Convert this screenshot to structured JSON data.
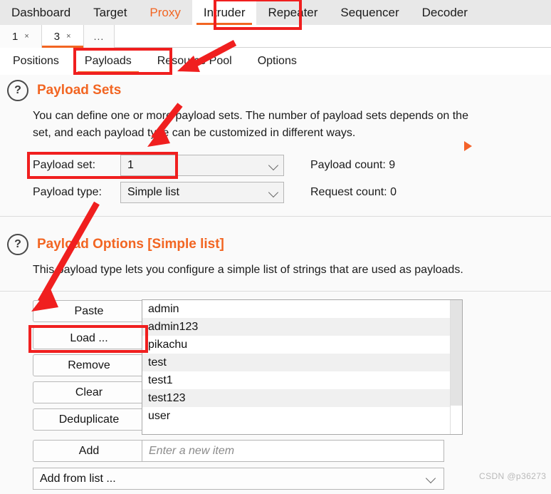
{
  "main_tabs": [
    {
      "label": "Dashboard",
      "state": "normal"
    },
    {
      "label": "Target",
      "state": "normal"
    },
    {
      "label": "Proxy",
      "state": "accent"
    },
    {
      "label": "Intruder",
      "state": "selected"
    },
    {
      "label": "Repeater",
      "state": "normal"
    },
    {
      "label": "Sequencer",
      "state": "normal"
    },
    {
      "label": "Decoder",
      "state": "normal"
    }
  ],
  "attack_tabs": [
    {
      "label": "1",
      "close": "×",
      "selected": false
    },
    {
      "label": "3",
      "close": "×",
      "selected": true
    }
  ],
  "attack_tabs_overflow": "...",
  "sub_tabs": [
    {
      "label": "Positions",
      "selected": false
    },
    {
      "label": "Payloads",
      "selected": true
    },
    {
      "label": "Resource Pool",
      "selected": false
    },
    {
      "label": "Options",
      "selected": false
    }
  ],
  "payload_sets": {
    "help_icon": "question-mark-icon",
    "title": "Payload Sets",
    "description_line1": "You can define one or more payload sets. The number of payload sets depends on the",
    "description_line2": "set, and each payload type can be customized in different ways.",
    "payload_set_label": "Payload set:",
    "payload_set_value": "1",
    "payload_type_label": "Payload type:",
    "payload_type_value": "Simple list",
    "payload_count": "Payload count: 9",
    "request_count": "Request count: 0"
  },
  "payload_options": {
    "help_icon": "question-mark-icon",
    "title": "Payload Options [Simple list]",
    "description": "This payload type lets you configure a simple list of strings that are used as payloads.",
    "buttons": [
      "Paste",
      "Load ...",
      "Remove",
      "Clear",
      "Deduplicate"
    ],
    "items": [
      "admin",
      "admin123",
      "pikachu",
      "test",
      "test1",
      "test123",
      "user"
    ],
    "add_button": "Add",
    "new_item_placeholder": "Enter a new item",
    "add_from_list": "Add from list ..."
  },
  "watermark": "CSDN @p36273",
  "colors": {
    "accent": "#f26522",
    "annotation": "#f01f1f",
    "tabbar_bg": "#e8e8e8",
    "panel_bg": "#fafafa"
  }
}
